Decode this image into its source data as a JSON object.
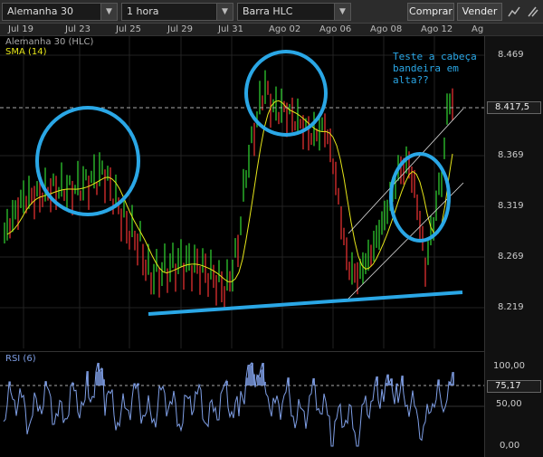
{
  "toolbar": {
    "instrument": "Alemanha 30",
    "timeframe": "1 hora",
    "chart_type": "Barra HLC",
    "buy_label": "Comprar",
    "sell_label": "Vender"
  },
  "date_axis": [
    "Jul 19",
    "Jul 23",
    "Jul 25",
    "Jul 29",
    "Jul 31",
    "Ago 02",
    "Ago 06",
    "Ago 08",
    "Ago 12",
    "Ag"
  ],
  "main_chart": {
    "series_label": "Alemanha 30 (HLC)",
    "indicator_label": "SMA (14)",
    "annotation_line1": "Teste a cabeça",
    "annotation_line2": "bandeira em alta??",
    "current_price_label": "8.417,5",
    "price_ticks": [
      "8.469",
      "8.369",
      "8.319",
      "8.269",
      "8.219"
    ]
  },
  "rsi": {
    "label": "RSI (6)",
    "current_value_label": "75,17",
    "ticks": [
      "100,00",
      "50,00",
      "0,00"
    ]
  },
  "colors": {
    "up_bar": "#2ec82e",
    "down_bar": "#e03030",
    "sma": "#e6e619",
    "annotation": "#2aa7e6",
    "rsi_line": "#7f9fe6",
    "rsi_fill": "#7f9fe6"
  },
  "chart_data": {
    "type": "bar",
    "title": "Alemanha 30 (HLC)",
    "series": [
      {
        "name": "SMA (14)",
        "values": [
          8280,
          8310,
          8320,
          8330,
          8330,
          8345,
          8335,
          8300,
          8260,
          8250,
          8245,
          8240,
          8280,
          8380,
          8410,
          8405,
          8390,
          8350,
          8300,
          8290,
          8300,
          8320,
          8330,
          8360
        ]
      }
    ],
    "x": [
      "Jul 19",
      "Jul 23",
      "Jul 25",
      "Jul 29",
      "Jul 31",
      "Ago 02",
      "Ago 06",
      "Ago 08",
      "Ago 12"
    ],
    "ylim": [
      8200,
      8480
    ],
    "last_price": 8417.5,
    "rsi_last": 75.17
  }
}
